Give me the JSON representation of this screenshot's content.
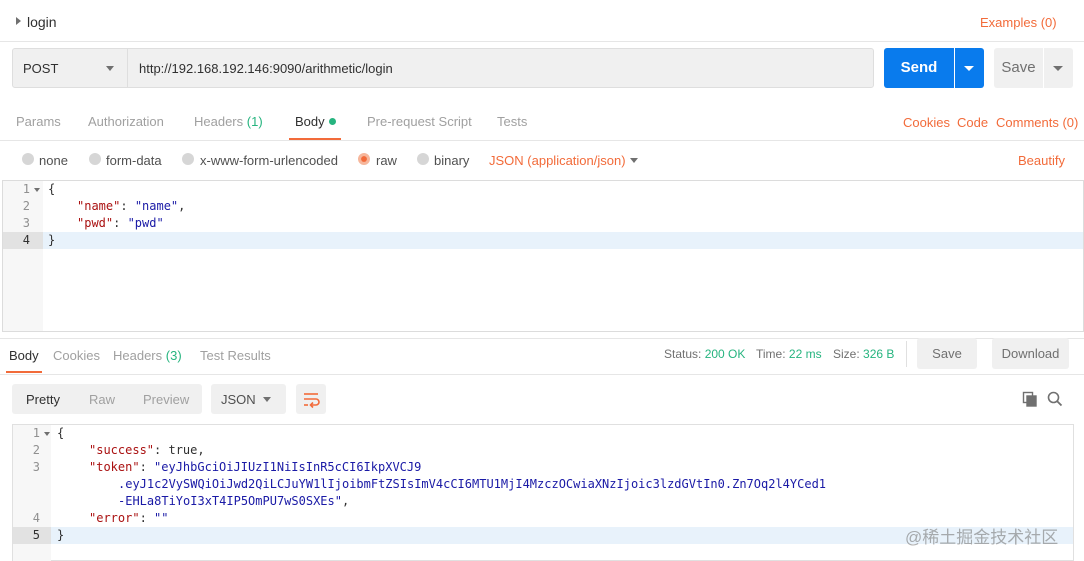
{
  "request": {
    "name": "login",
    "examples_label": "Examples (0)",
    "method": "POST",
    "url": "http://192.168.192.146:9090/arithmetic/login",
    "send_label": "Send",
    "save_label": "Save"
  },
  "request_tabs": {
    "params": "Params",
    "authorization": "Authorization",
    "headers": "Headers",
    "headers_count": "(1)",
    "body": "Body",
    "prerequest": "Pre-request Script",
    "tests": "Tests",
    "cookies": "Cookies",
    "code": "Code",
    "comments": "Comments (0)"
  },
  "body_options": {
    "none": "none",
    "form_data": "form-data",
    "urlencoded": "x-www-form-urlencoded",
    "raw": "raw",
    "binary": "binary",
    "content_type": "JSON (application/json)",
    "beautify": "Beautify"
  },
  "request_body": {
    "line_numbers": [
      "1",
      "2",
      "3",
      "4"
    ],
    "l1": "{",
    "l2_key": "\"name\"",
    "l2_sep": ": ",
    "l2_val": "\"name\"",
    "l2_end": ",",
    "l3_key": "\"pwd\"",
    "l3_sep": ": ",
    "l3_val": "\"pwd\"",
    "l4": "}"
  },
  "response_tabs": {
    "body": "Body",
    "cookies": "Cookies",
    "headers": "Headers",
    "headers_count": "(3)",
    "test_results": "Test Results"
  },
  "response_status": {
    "status_label": "Status:",
    "status_value": "200 OK",
    "time_label": "Time:",
    "time_value": "22 ms",
    "size_label": "Size:",
    "size_value": "326 B",
    "save_label": "Save",
    "download_label": "Download"
  },
  "response_view": {
    "pretty": "Pretty",
    "raw": "Raw",
    "preview": "Preview",
    "format": "JSON"
  },
  "response_body": {
    "line_numbers": [
      "1",
      "2",
      "3",
      "4",
      "5"
    ],
    "l1": "{",
    "l2_key": "\"success\"",
    "l2_rest": ": true,",
    "l3_key": "\"token\"",
    "l3_sep": ": ",
    "l3_val_a": "\"eyJhbGciOiJIUzI1NiIsInR5cCI6IkpXVCJ9",
    "l3_val_b": ".eyJ1c2VySWQiOiJwd2QiLCJuYW1lIjoibmFtZSIsImV4cCI6MTU1MjI4MzczOCwiaXNzIjoic3lzdGVtIn0.Zn7Oq2l4YCed1",
    "l3_val_c": "-EHLa8TiYoI3xT4IP5OmPU7wS0SXEs\"",
    "l3_end": ",",
    "l4_key": "\"error\"",
    "l4_sep": ": ",
    "l4_val": "\"\"",
    "l5": "}"
  },
  "watermark": "@稀土掘金技术社区",
  "colors": {
    "accent_orange": "#f26b3a",
    "send_blue": "#097bed",
    "status_green": "#26b47f"
  }
}
